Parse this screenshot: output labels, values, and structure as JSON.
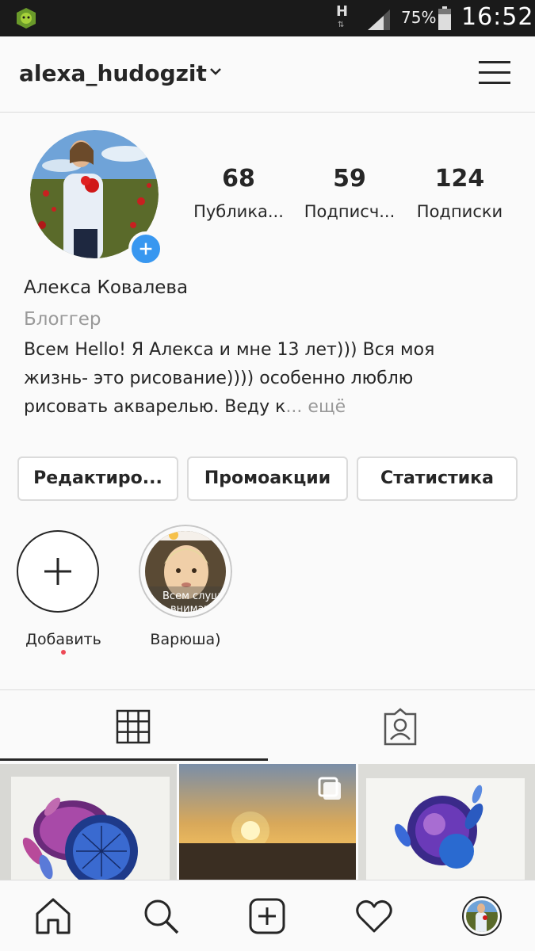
{
  "status_bar": {
    "network_type": "H",
    "battery_percent": "75%",
    "time": "16:52"
  },
  "header": {
    "username": "alexa_hudogzit",
    "icons": [
      "chevron-down-icon",
      "menu-icon"
    ]
  },
  "profile": {
    "stats": [
      {
        "value": "68",
        "label": "Публика..."
      },
      {
        "value": "59",
        "label": "Подписч..."
      },
      {
        "value": "124",
        "label": "Подписки"
      }
    ],
    "full_name": "Алекса Ковалева",
    "category": "Блоггер",
    "bio_lines": [
      "Всем Hello!   Я Алекса и мне 13 лет)))  Вся моя",
      "жизнь- это рисование)))) особенно люблю",
      "рисовать акварелью. Веду к"
    ],
    "bio_ellipsis": "...",
    "bio_more": "ещё"
  },
  "buttons": {
    "edit": "Редактиро...",
    "promotions": "Промоакции",
    "statistics": "Статистика"
  },
  "highlights": [
    {
      "label": "Добавить"
    },
    {
      "label": "Варюша)",
      "overlay_text_1": "Всем слуш",
      "overlay_text_2": "внимат"
    }
  ],
  "tabs": [
    "grid-icon",
    "tagged-icon"
  ],
  "bottom_nav": [
    "home-icon",
    "search-icon",
    "new-post-icon",
    "activity-heart-icon",
    "profile-avatar"
  ],
  "colors": {
    "accent_blue": "#3897f0",
    "notification_red": "#ed4956",
    "text_primary": "#262626",
    "text_secondary": "#999999",
    "border": "#dbdbdb"
  }
}
